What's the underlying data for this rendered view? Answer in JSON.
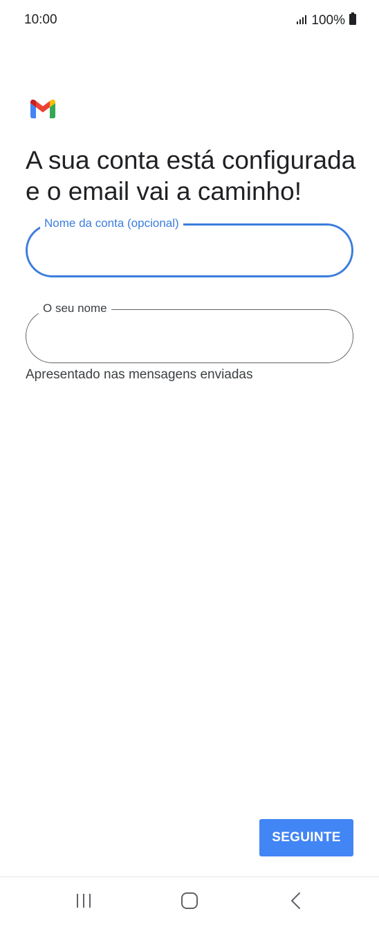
{
  "status_bar": {
    "time": "10:00",
    "battery": "100%",
    "signal_icon": "signal-bars-icon",
    "battery_icon": "battery-full-icon"
  },
  "header": {
    "logo_icon": "gmail-logo",
    "title": "A sua conta está configurada e o email vai a caminho!"
  },
  "form": {
    "account_name": {
      "label": "Nome da conta (opcional)",
      "value": "",
      "focused": true
    },
    "your_name": {
      "label": "O seu nome",
      "value": "",
      "helper": "Apresentado nas mensagens enviadas"
    }
  },
  "actions": {
    "next_label": "SEGUINTE"
  },
  "nav_bar": {
    "recent_icon": "recent-apps-icon",
    "home_icon": "home-icon",
    "back_icon": "back-icon"
  },
  "colors": {
    "accent": "#3b7ddd",
    "button": "#4285f4",
    "gmail_red": "#ea4335",
    "gmail_blue": "#4285f4",
    "gmail_green": "#34a853",
    "gmail_yellow": "#fbbc04"
  }
}
